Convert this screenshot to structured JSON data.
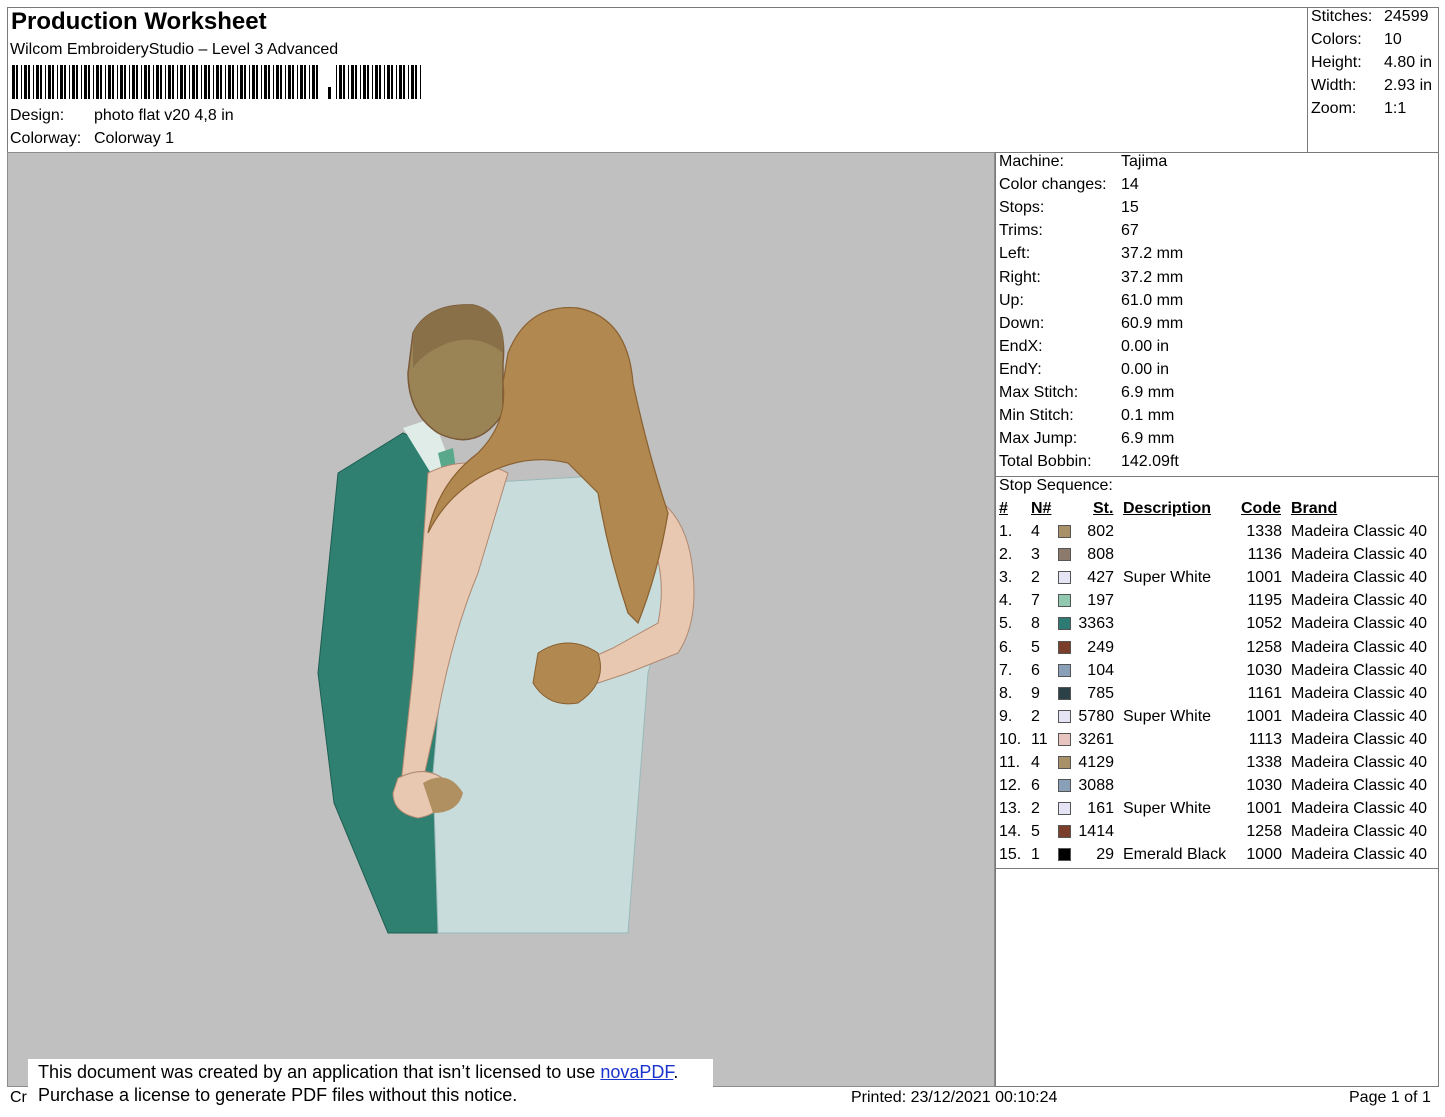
{
  "header": {
    "title": "Production Worksheet",
    "subtitle": "Wilcom EmbroideryStudio – Level 3 Advanced",
    "design_label": "Design:",
    "design_value": "photo flat v20 4,8 in",
    "colorway_label": "Colorway:",
    "colorway_value": "Colorway 1"
  },
  "summary": [
    {
      "label": "Stitches:",
      "value": "24599"
    },
    {
      "label": "Colors:",
      "value": "10"
    },
    {
      "label": "Height:",
      "value": "4.80 in"
    },
    {
      "label": "Width:",
      "value": "2.93 in"
    },
    {
      "label": "Zoom:",
      "value": "1:1"
    }
  ],
  "machine_info": [
    {
      "label": "Machine:",
      "value": "Tajima"
    },
    {
      "label": "Color changes:",
      "value": "14"
    },
    {
      "label": "Stops:",
      "value": "15"
    },
    {
      "label": "Trims:",
      "value": "67"
    },
    {
      "label": "Left:",
      "value": "37.2 mm"
    },
    {
      "label": "Right:",
      "value": "37.2 mm"
    },
    {
      "label": "Up:",
      "value": "61.0 mm"
    },
    {
      "label": "Down:",
      "value": "60.9 mm"
    },
    {
      "label": "EndX:",
      "value": "0.00 in"
    },
    {
      "label": "EndY:",
      "value": "0.00 in"
    },
    {
      "label": "Max Stitch:",
      "value": "6.9 mm"
    },
    {
      "label": "Min Stitch:",
      "value": "0.1 mm"
    },
    {
      "label": "Max Jump:",
      "value": "6.9 mm"
    },
    {
      "label": "Total Bobbin:",
      "value": "142.09ft"
    }
  ],
  "stop_sequence": {
    "title": "Stop Sequence:",
    "headers": {
      "num": "#",
      "n": "N#",
      "st": "St.",
      "description": "Description",
      "code": "Code",
      "brand": "Brand"
    },
    "rows": [
      {
        "num": "1.",
        "n": "4",
        "color": "#a89068",
        "st": "802",
        "description": "",
        "code": "1338",
        "brand": "Madeira Classic 40"
      },
      {
        "num": "2.",
        "n": "3",
        "color": "#8c7a6c",
        "st": "808",
        "description": "",
        "code": "1136",
        "brand": "Madeira Classic 40"
      },
      {
        "num": "3.",
        "n": "2",
        "color": "#e4e4f4",
        "st": "427",
        "description": "Super White",
        "code": "1001",
        "brand": "Madeira Classic 40"
      },
      {
        "num": "4.",
        "n": "7",
        "color": "#90c8b0",
        "st": "197",
        "description": "",
        "code": "1195",
        "brand": "Madeira Classic 40"
      },
      {
        "num": "5.",
        "n": "8",
        "color": "#2e7a74",
        "st": "3363",
        "description": "",
        "code": "1052",
        "brand": "Madeira Classic 40"
      },
      {
        "num": "6.",
        "n": "5",
        "color": "#7a3e2a",
        "st": "249",
        "description": "",
        "code": "1258",
        "brand": "Madeira Classic 40"
      },
      {
        "num": "7.",
        "n": "6",
        "color": "#8aa0b8",
        "st": "104",
        "description": "",
        "code": "1030",
        "brand": "Madeira Classic 40"
      },
      {
        "num": "8.",
        "n": "9",
        "color": "#2c4048",
        "st": "785",
        "description": "",
        "code": "1161",
        "brand": "Madeira Classic 40"
      },
      {
        "num": "9.",
        "n": "2",
        "color": "#e4e4f4",
        "st": "5780",
        "description": "Super White",
        "code": "1001",
        "brand": "Madeira Classic 40"
      },
      {
        "num": "10.",
        "n": "11",
        "color": "#e8c4c0",
        "st": "3261",
        "description": "",
        "code": "1113",
        "brand": "Madeira Classic 40"
      },
      {
        "num": "11.",
        "n": "4",
        "color": "#a89068",
        "st": "4129",
        "description": "",
        "code": "1338",
        "brand": "Madeira Classic 40"
      },
      {
        "num": "12.",
        "n": "6",
        "color": "#8aa0b8",
        "st": "3088",
        "description": "",
        "code": "1030",
        "brand": "Madeira Classic 40"
      },
      {
        "num": "13.",
        "n": "2",
        "color": "#e4e4f4",
        "st": "161",
        "description": "Super White",
        "code": "1001",
        "brand": "Madeira Classic 40"
      },
      {
        "num": "14.",
        "n": "5",
        "color": "#7a3e2a",
        "st": "1414",
        "description": "",
        "code": "1258",
        "brand": "Madeira Classic 40"
      },
      {
        "num": "15.",
        "n": "1",
        "color": "#000000",
        "st": "29",
        "description": "Emerald Black",
        "code": "1000",
        "brand": "Madeira Classic 40"
      }
    ]
  },
  "notice": {
    "line1_prefix": "This document was created by an application that isn’t licensed to use ",
    "link": "novaPDF",
    "line1_suffix": ".",
    "line2": "Purchase a license to generate PDF files without this notice."
  },
  "footer": {
    "left_fragment": "Cr",
    "printed": "Printed: 23/12/2021 00:10:24",
    "page": "Page 1 of 1"
  },
  "colors": {
    "canvas": "#c0c0c0",
    "suit": "#2f8070",
    "dress": "#c8dcdc",
    "skin": "#e8c8b0",
    "hair": "#b08850"
  }
}
